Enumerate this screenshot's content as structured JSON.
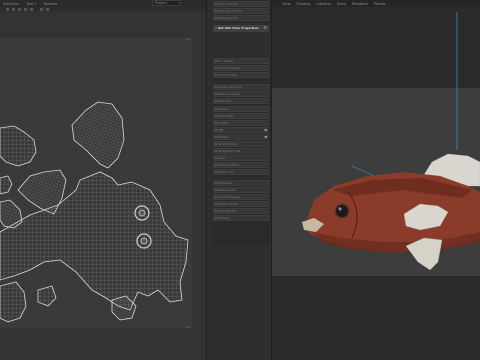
{
  "uv_editor": {
    "menu": [
      "Selection",
      "Tool 1",
      "Toolsets"
    ],
    "dropdown_value": "Project",
    "corner_labels": {
      "top_right": "1,1",
      "bottom_right": "1,0"
    }
  },
  "tools_panel": {
    "items": [
      {
        "label": "Auto Unwrap",
        "active": false
      },
      {
        "label": "Unwrap UV Tool",
        "active": false
      },
      {
        "label": "Optimize UVs",
        "active": false
      },
      {
        "label": "Set UVs from Projection",
        "active": true
      },
      {
        "label": "UV Toolkit",
        "active": false
      },
      {
        "label": "Camera-Based",
        "active": false
      },
      {
        "label": "Cut and Sew",
        "active": false
      },
      {
        "label": "Create UV Shell",
        "active": false
      },
      {
        "label": "Move and Sew",
        "active": false
      },
      {
        "label": "Split UVs",
        "active": false
      },
      {
        "label": "Layout",
        "active": false
      },
      {
        "label": "Normalize",
        "active": false
      },
      {
        "label": "Unitize",
        "active": false
      },
      {
        "label": "Flip",
        "active": false
      },
      {
        "label": "Rotate",
        "active": false
      },
      {
        "label": "Orient Shells",
        "active": false
      },
      {
        "label": "Straighten UVs",
        "active": false
      },
      {
        "label": "Align",
        "active": false
      },
      {
        "label": "Snap Together",
        "active": false
      },
      {
        "label": "Match UVs",
        "active": false
      },
      {
        "label": "Distribute",
        "active": false
      },
      {
        "label": "Stack Shells",
        "active": false
      },
      {
        "label": "Unstack Shells",
        "active": false
      },
      {
        "label": "Gather Shells",
        "active": false
      },
      {
        "label": "Symmetrize",
        "active": false
      },
      {
        "label": "Pinning",
        "active": false
      }
    ]
  },
  "viewport": {
    "menu": [
      "View",
      "Shading",
      "Lighting",
      "Show",
      "Renderer",
      "Panels"
    ]
  },
  "colors": {
    "accent": "#3fa8ff",
    "uv_background": "#3a3a3a",
    "viewport_background": "#3d3d3d",
    "fish_body": "#8a3b2a"
  }
}
